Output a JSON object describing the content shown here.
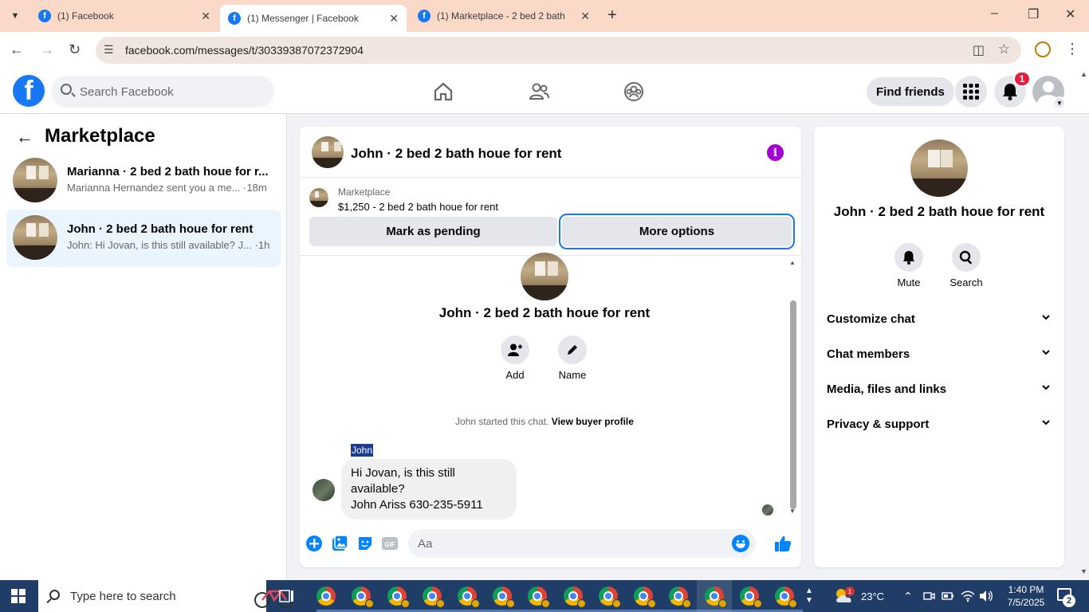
{
  "browser": {
    "tabs": [
      {
        "title": "(1) Facebook",
        "active": false
      },
      {
        "title": "(1) Messenger | Facebook",
        "active": true
      },
      {
        "title": "(1) Marketplace - 2 bed 2 bath",
        "active": false
      }
    ],
    "url": "facebook.com/messages/t/30339387072372904"
  },
  "fb": {
    "search_placeholder": "Search Facebook",
    "find_friends": "Find friends",
    "notifications_count": "1",
    "brand_color": "#1877f2"
  },
  "sidebar": {
    "title": "Marketplace",
    "conversations": [
      {
        "name": "Marianna · 2 bed 2 bath houe for r...",
        "preview": "Marianna Hernandez sent you a me... ·18m"
      },
      {
        "name": "John · 2 bed 2 bath houe for rent",
        "preview": "John: Hi Jovan, is this still available? J... ·1h"
      }
    ]
  },
  "chat": {
    "title": "John · 2 bed 2 bath houe for rent",
    "marketplace_label": "Marketplace",
    "listing": "$1,250 - 2 bed 2 bath houe for rent",
    "mark_pending": "Mark as pending",
    "more_options": "More options",
    "profile_name": "John · 2 bed 2 bath houe for rent",
    "actions": [
      {
        "label": "Add"
      },
      {
        "label": "Name"
      }
    ],
    "started_text": "John started this chat.",
    "view_profile": "View buyer profile",
    "sender": "John",
    "message_line1": "Hi Jovan, is this still available?",
    "message_line2": "John Ariss 630-235-5911",
    "composer_placeholder": "Aa"
  },
  "info_panel": {
    "name": "John · 2 bed 2 bath houe for rent",
    "actions": [
      {
        "label": "Mute"
      },
      {
        "label": "Search"
      }
    ],
    "sections": [
      "Customize chat",
      "Chat members",
      "Media, files and links",
      "Privacy & support"
    ]
  },
  "taskbar": {
    "search_placeholder": "Type here to search",
    "weather_badge": "1",
    "temperature": "23°C",
    "time": "1:40 PM",
    "date": "7/5/2025",
    "notification_count": "2"
  }
}
